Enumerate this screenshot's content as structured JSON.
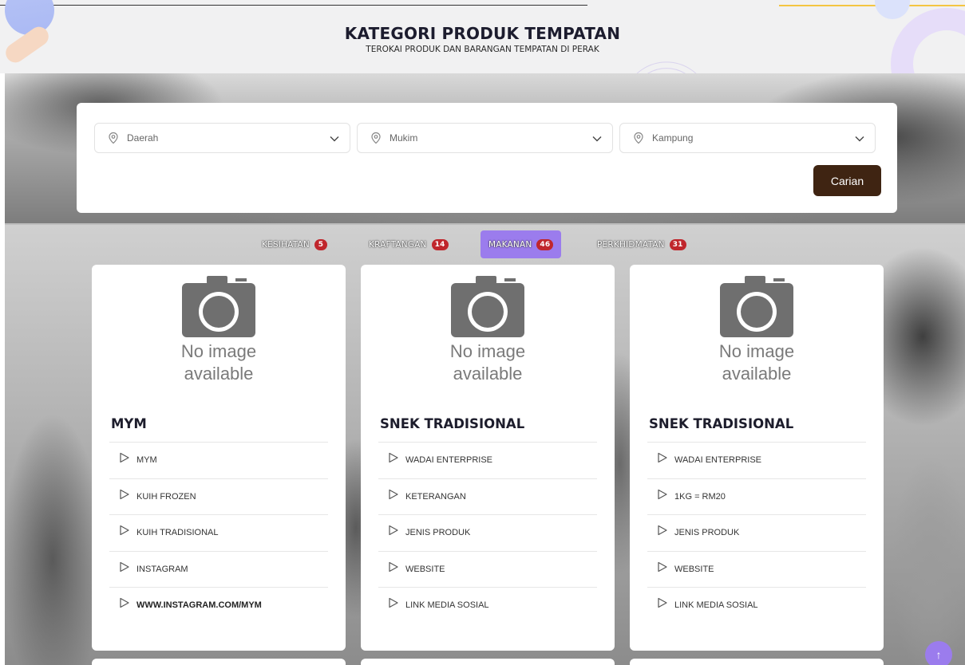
{
  "header": {
    "title": "KATEGORI PRODUK TEMPATAN",
    "subtitle": "TEROKAI PRODUK DAN BARANGAN TEMPATAN DI PERAK"
  },
  "search": {
    "selects": [
      {
        "placeholder": "Daerah",
        "icon": "location-pin-icon"
      },
      {
        "placeholder": "Mukim",
        "icon": "location-pin-icon"
      },
      {
        "placeholder": "Kampung",
        "icon": "location-pin-icon"
      }
    ],
    "button_label": "Carian"
  },
  "tabs": [
    {
      "label": "KESIHATAN",
      "count": "5",
      "active": false
    },
    {
      "label": "KRAFTANGAN",
      "count": "14",
      "active": false
    },
    {
      "label": "MAKANAN",
      "count": "46",
      "active": true
    },
    {
      "label": "PERKHIDMATAN",
      "count": "31",
      "active": false
    }
  ],
  "no_image": {
    "line1": "No image",
    "line2": "available"
  },
  "cards": [
    {
      "title": "MYM",
      "items": [
        "MYM",
        "KUIH FROZEN",
        "KUIH TRADISIONAL",
        "INSTAGRAM",
        "WWW.INSTAGRAM.COM/MYM"
      ]
    },
    {
      "title": "SNEK TRADISIONAL",
      "items": [
        "WADAI ENTERPRISE",
        "KETERANGAN",
        "JENIS PRODUK",
        "WEBSITE",
        "LINK MEDIA SOSIAL"
      ]
    },
    {
      "title": "SNEK TRADISIONAL",
      "items": [
        "WADAI ENTERPRISE",
        "1KG = RM20",
        "JENIS PRODUK",
        "WEBSITE",
        "LINK MEDIA SOSIAL"
      ]
    }
  ],
  "scroll_top": {
    "icon": "arrow-up-icon",
    "glyph": "↑"
  },
  "colors": {
    "accent": "#9b7ced",
    "button": "#3f2412",
    "badge": "#c0262c"
  }
}
